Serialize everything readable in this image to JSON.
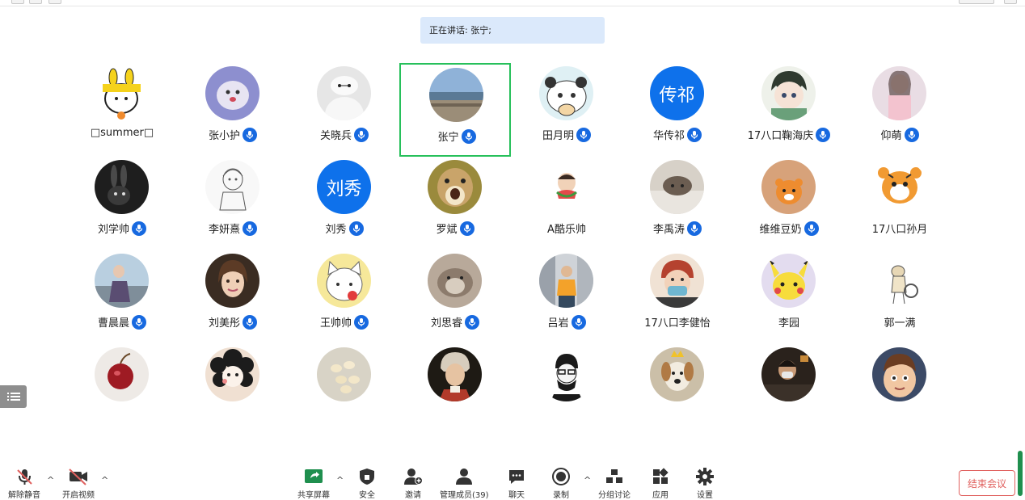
{
  "speaking_banner": "正在讲话: 张宁;",
  "participants": [
    {
      "name": "□summer□",
      "mic": false,
      "avatar": "duck"
    },
    {
      "name": "张小护",
      "mic": true,
      "avatar": "ghost"
    },
    {
      "name": "关晓兵",
      "mic": true,
      "avatar": "baymax"
    },
    {
      "name": "张宁",
      "mic": true,
      "avatar": "beach",
      "active": true
    },
    {
      "name": "田月明",
      "mic": true,
      "avatar": "bear"
    },
    {
      "name": "华传祁",
      "mic": true,
      "avatar_text": "传祁"
    },
    {
      "name": "17八口鞠海庆",
      "mic": true,
      "avatar": "anime-boy"
    },
    {
      "name": "仰萌",
      "mic": true,
      "avatar": "girl-pink"
    },
    {
      "name": "刘学帅",
      "mic": true,
      "avatar": "bunny"
    },
    {
      "name": "李妍熹",
      "mic": true,
      "avatar": "sketch"
    },
    {
      "name": "刘秀",
      "mic": true,
      "avatar_text": "刘秀"
    },
    {
      "name": "罗斌",
      "mic": true,
      "avatar": "squirrel"
    },
    {
      "name": "A酷乐帅",
      "mic": false,
      "avatar": "kid-melon"
    },
    {
      "name": "李禹涛",
      "mic": true,
      "avatar": "cat-blanket"
    },
    {
      "name": "维维豆奶",
      "mic": true,
      "avatar": "tiger-card"
    },
    {
      "name": "17八口孙月",
      "mic": false,
      "avatar": "tiger-cartoon"
    },
    {
      "name": "曹晨晨",
      "mic": true,
      "avatar": "woman-sea"
    },
    {
      "name": "刘美彤",
      "mic": true,
      "avatar": "girl-hair"
    },
    {
      "name": "王帅帅",
      "mic": true,
      "avatar": "cat-cartoon"
    },
    {
      "name": "刘思睿",
      "mic": true,
      "avatar": "cat-photo"
    },
    {
      "name": "吕岩",
      "mic": true,
      "avatar": "man-street"
    },
    {
      "name": "17八口李健怡",
      "mic": false,
      "avatar": "boy-mask"
    },
    {
      "name": "李园",
      "mic": false,
      "avatar": "pikachu"
    },
    {
      "name": "郭一满",
      "mic": false,
      "avatar": "cat-drawing"
    },
    {
      "name": "",
      "mic": false,
      "avatar": "cherry"
    },
    {
      "name": "",
      "mic": false,
      "avatar": "curly-girl"
    },
    {
      "name": "",
      "mic": false,
      "avatar": "garlic"
    },
    {
      "name": "",
      "mic": false,
      "avatar": "mozart"
    },
    {
      "name": "",
      "mic": false,
      "avatar": "hipster"
    },
    {
      "name": "",
      "mic": false,
      "avatar": "dog"
    },
    {
      "name": "",
      "mic": false,
      "avatar": "man-dark"
    },
    {
      "name": "",
      "mic": false,
      "avatar": "cartoon-boy"
    }
  ],
  "toolbar": {
    "unmute": "解除静音",
    "start_video": "开启视频",
    "share_screen": "共享屏幕",
    "security": "安全",
    "invite": "邀请",
    "manage_members": "管理成员(39)",
    "chat": "聊天",
    "record": "录制",
    "breakout": "分组讨论",
    "apps": "应用",
    "settings": "设置",
    "end_meeting": "结束会议"
  },
  "colors": {
    "accent": "#0e71eb",
    "active_border": "#27c05b",
    "end": "#e0605e",
    "banner": "#dbe9fb"
  }
}
